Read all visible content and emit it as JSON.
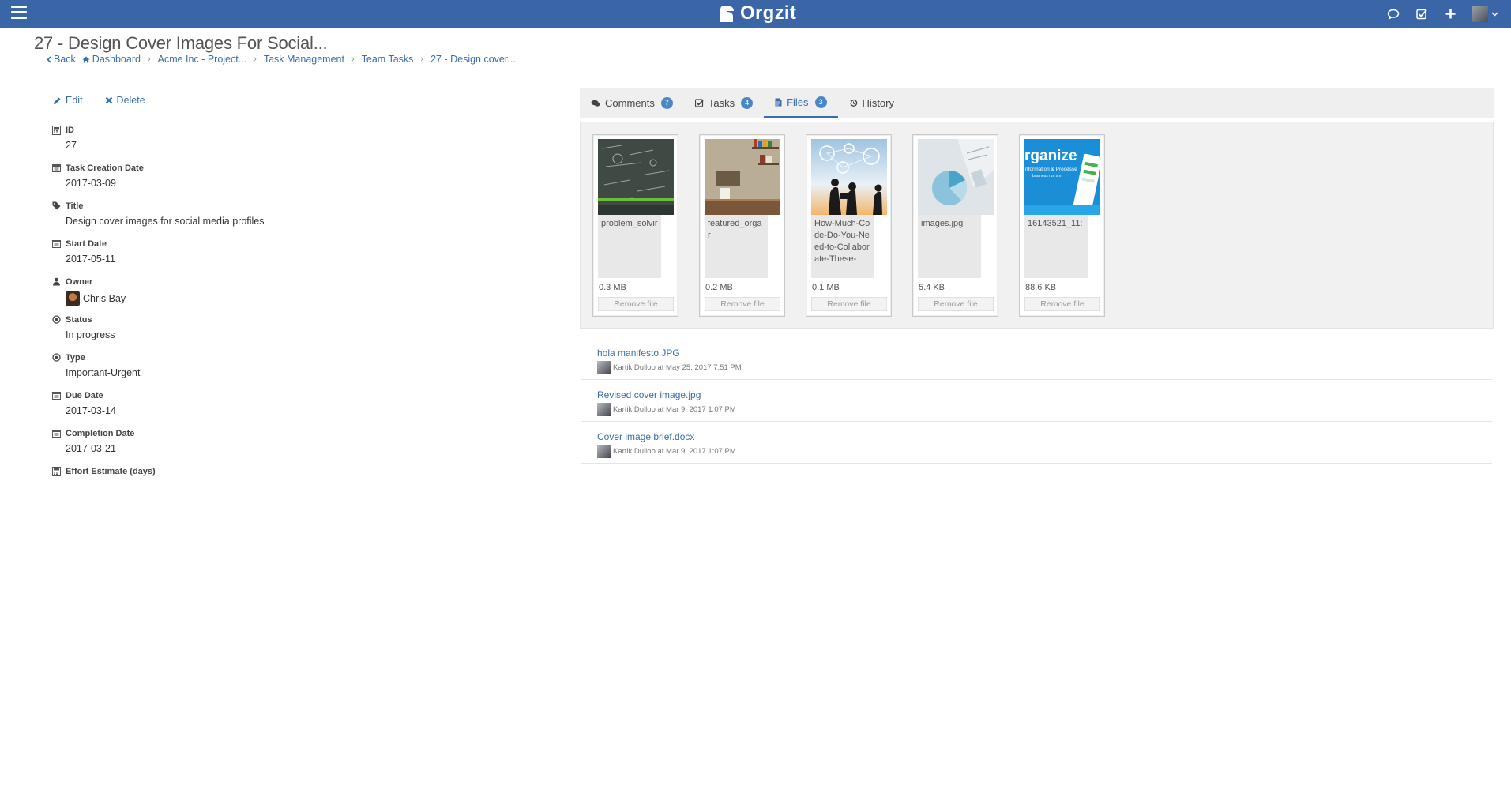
{
  "app": {
    "brand_name": "Orgzit",
    "accent_color": "#3a66a7"
  },
  "topbar_icons": [
    "chat-bubble-icon",
    "checkbox-icon",
    "plus-icon",
    "user-avatar-dropdown"
  ],
  "page": {
    "title": "27 - Design Cover Images For Social...",
    "breadcrumb": {
      "back": "Back",
      "items": [
        "Dashboard",
        "Acme Inc - Project...",
        "Task Management",
        "Team Tasks",
        "27 - Design cover..."
      ]
    }
  },
  "actions": {
    "edit": "Edit",
    "delete": "Delete"
  },
  "fields": [
    {
      "label": "ID",
      "value": "27",
      "icon": "calculator-icon"
    },
    {
      "label": "Task Creation Date",
      "value": "2017-03-09",
      "icon": "calendar-icon"
    },
    {
      "label": "Title",
      "value": "Design cover images for social media profiles",
      "icon": "tag-icon"
    },
    {
      "label": "Start Date",
      "value": "2017-05-11",
      "icon": "calendar-icon"
    },
    {
      "label": "Owner",
      "value": "Chris Bay",
      "icon": "user-icon"
    },
    {
      "label": "Status",
      "value": "In progress",
      "icon": "target-icon"
    },
    {
      "label": "Type",
      "value": "Important-Urgent",
      "icon": "target-icon"
    },
    {
      "label": "Due Date",
      "value": "2017-03-14",
      "icon": "calendar-icon"
    },
    {
      "label": "Completion Date",
      "value": "2017-03-21",
      "icon": "calendar-icon"
    },
    {
      "label": "Effort Estimate (days)",
      "value": "--",
      "icon": "calculator-icon"
    }
  ],
  "tabs": [
    {
      "label": "Comments",
      "count": "7",
      "icon": "comments-icon",
      "active": false
    },
    {
      "label": "Tasks",
      "count": "4",
      "icon": "check-square-icon",
      "active": false
    },
    {
      "label": "Files",
      "count": "3",
      "icon": "file-icon",
      "active": true
    },
    {
      "label": "History",
      "count": "",
      "icon": "history-icon",
      "active": false
    }
  ],
  "file_cards": [
    {
      "name": "problem_solvir",
      "size": "0.3 MB",
      "remove": "Remove file",
      "thumb": "chalkboard"
    },
    {
      "name": "featured_orgar",
      "size": "0.2 MB",
      "remove": "Remove file",
      "thumb": "desk"
    },
    {
      "name": "How-Much-Code-Do-You-Need-to-Collaborate-These-",
      "size": "0.1 MB",
      "remove": "Remove file",
      "thumb": "people"
    },
    {
      "name": "images.jpg",
      "size": "5.4 KB",
      "remove": "Remove file",
      "thumb": "pie"
    },
    {
      "name": "16143521_11:",
      "size": "88.6 KB",
      "remove": "Remove file",
      "thumb": "organize"
    }
  ],
  "file_list": [
    {
      "name": "hola manifesto.JPG",
      "meta": "Kartik Dulloo at May 25, 2017 7:51 PM"
    },
    {
      "name": "Revised cover image.jpg",
      "meta": "Kartik Dulloo at Mar 9, 2017 1:07 PM"
    },
    {
      "name": "Cover image brief.docx",
      "meta": "Kartik Dulloo at Mar 9, 2017 1:07 PM"
    }
  ],
  "thumb_text": {
    "organize_title": "rganize",
    "organize_sub1": "nformation & Processe",
    "organize_sub2": "business run sm"
  }
}
